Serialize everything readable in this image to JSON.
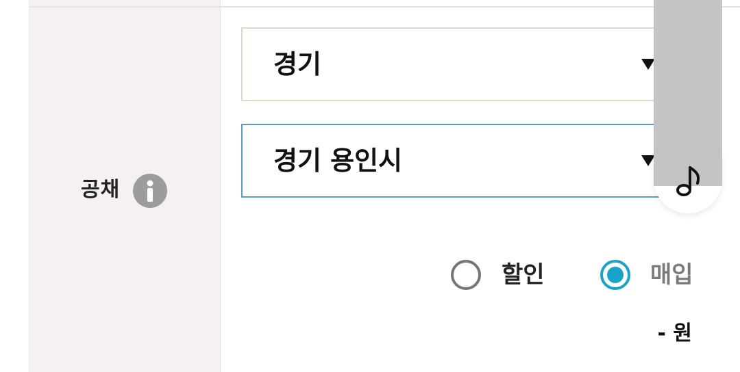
{
  "form": {
    "field_label": "공채",
    "province_select": {
      "value": "경기"
    },
    "city_select": {
      "value": "경기 용인시"
    },
    "radio_options": [
      {
        "label": "할인",
        "selected": false
      },
      {
        "label": "매입",
        "selected": true
      }
    ],
    "amount_text": "- 원"
  },
  "icons": {
    "info": "info-icon",
    "dropdown": "triangle-down-icon",
    "floating": "music-note-icon"
  },
  "colors": {
    "label_background": "#f5f1f0",
    "selected_radio": "#1aa3c8",
    "unselected_radio": "#767676",
    "active_select_border": "#5b9dc0",
    "floating_bar": "#c4c4c4"
  }
}
